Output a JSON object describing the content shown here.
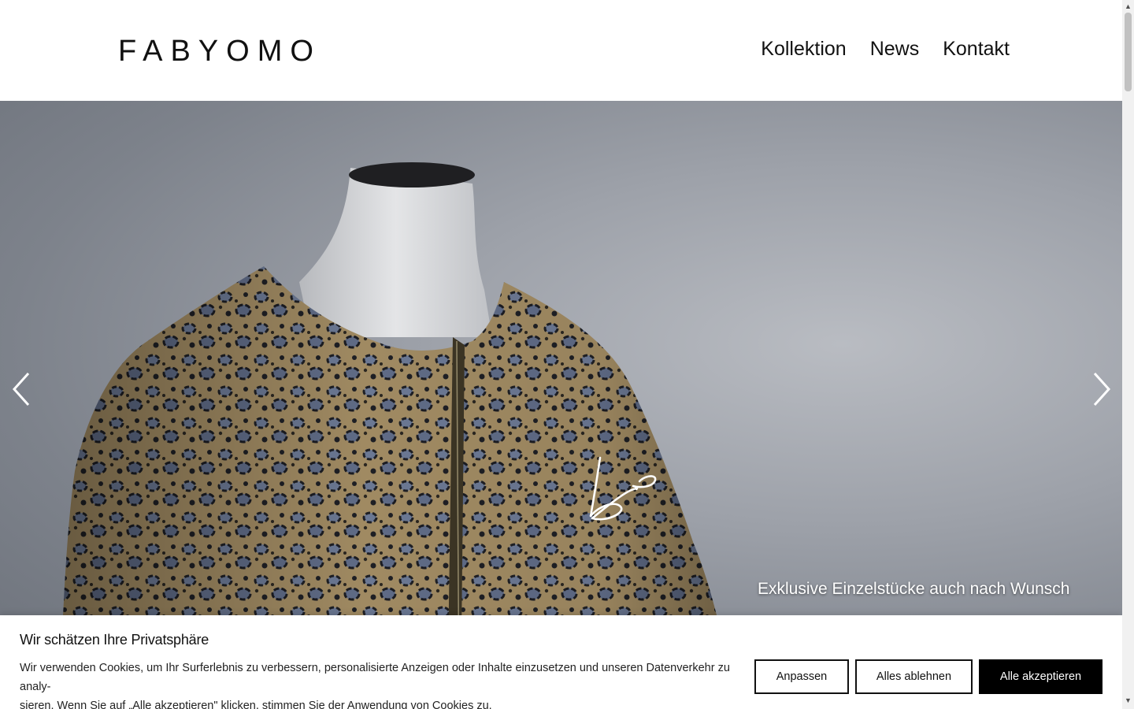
{
  "header": {
    "logo": "FABYOMO",
    "nav": [
      {
        "label": "Kollektion"
      },
      {
        "label": "News"
      },
      {
        "label": "Kontakt"
      }
    ]
  },
  "hero": {
    "caption": "Exklusive Einzelstücke auch nach Wunsch",
    "prev_icon": "chevron-left-icon",
    "next_icon": "chevron-right-icon",
    "signature_icon": "signature-logo-icon"
  },
  "cookie_banner": {
    "title": "Wir schätzen Ihre Privatsphäre",
    "text_line1": "Wir verwenden Cookies, um Ihr Surferlebnis zu verbessern, personalisierte Anzeigen oder Inhalte einzusetzen und unseren Datenverkehr zu analy-",
    "text_line2": "sieren. Wenn Sie auf „Alle akzeptieren\" klicken, stimmen Sie der Anwendung von Cookies zu.",
    "buttons": {
      "customize": "Anpassen",
      "reject": "Alles ablehnen",
      "accept": "Alle akzeptieren"
    }
  },
  "scrollbar": {
    "up_icon": "▲",
    "down_icon": "▼"
  },
  "colors": {
    "background": "#ffffff",
    "text": "#111111",
    "accept_button": "#000000",
    "hero_backdrop": "#9da1a9"
  }
}
